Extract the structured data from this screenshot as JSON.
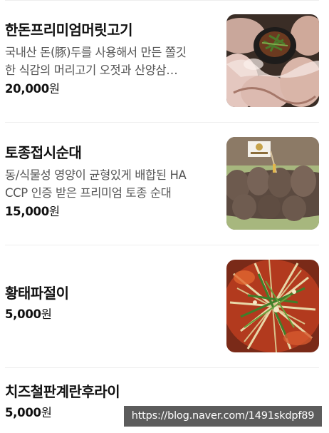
{
  "menu": {
    "items": [
      {
        "name": "한돈프리미엄머릿고기",
        "desc_line1": "국내산 돈(豚)두를 사용해서 만든 쫄깃",
        "desc_line2": "한 식감의 머리고기 오젓과 산양삼…",
        "price": "20,000",
        "currency": "원",
        "image": "sliced-pork-head-meat-photo"
      },
      {
        "name": "토종접시순대",
        "desc_line1": "동/식물성 영양이 균형있게 배합된 HA",
        "desc_line2": "CCP 인증 받은 프리미엄 토종 순대",
        "price": "15,000",
        "currency": "원",
        "image": "korean-sausage-sundae-photo"
      },
      {
        "name": "황태파절이",
        "desc_line1": "",
        "desc_line2": "",
        "price": "5,000",
        "currency": "원",
        "image": "dried-pollack-scallion-salad-photo"
      },
      {
        "name": "치즈철판계란후라이",
        "desc_line1": "",
        "desc_line2": "",
        "price": "5,000",
        "currency": "원",
        "image": ""
      }
    ]
  },
  "watermark": {
    "url": "https://blog.naver.com/1491skdpf89"
  }
}
